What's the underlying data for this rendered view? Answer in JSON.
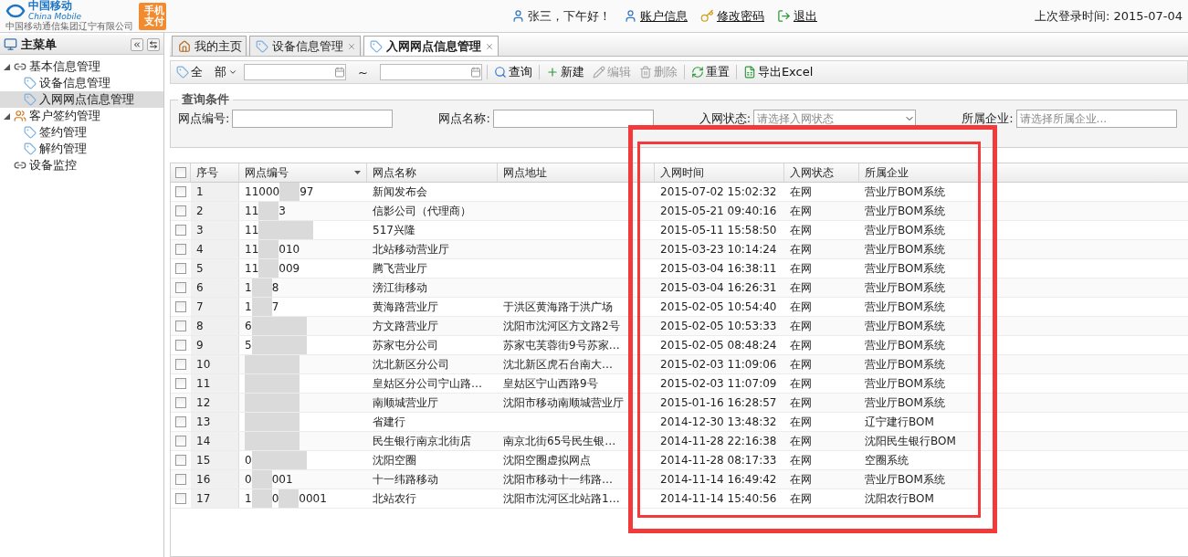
{
  "header": {
    "brand": {
      "name": "中国移动",
      "name_en": "China Mobile",
      "company": "中国移动通信集团辽宁有限公司",
      "app_badge": "手机支付"
    },
    "greeting": "张三，下午好！",
    "links": [
      "账户信息",
      "修改密码",
      "退出"
    ],
    "last_login": "上次登录时间: 2015-07-04"
  },
  "sidebar": {
    "title": "主菜单",
    "items": [
      {
        "label": "基本信息管理",
        "expanded": true,
        "selected": false,
        "children": [
          {
            "label": "设备信息管理",
            "selected": false
          },
          {
            "label": "入网网点信息管理",
            "selected": true
          }
        ]
      },
      {
        "label": "客户签约管理",
        "expanded": true,
        "selected": false,
        "children": [
          {
            "label": "签约管理",
            "selected": false
          },
          {
            "label": "解约管理",
            "selected": false
          }
        ]
      },
      {
        "label": "设备监控",
        "selected": false
      }
    ]
  },
  "tabs": [
    {
      "label": "我的主页",
      "selected": false,
      "closable": false
    },
    {
      "label": "设备信息管理",
      "selected": false,
      "closable": true
    },
    {
      "label": "入网网点信息管理",
      "selected": true,
      "closable": true
    }
  ],
  "toolbar": {
    "range_select": "全　部",
    "range_separator": "~",
    "buttons": [
      {
        "label": "查询",
        "disabled": false
      },
      {
        "label": "新建",
        "disabled": false
      },
      {
        "label": "编辑",
        "disabled": true
      },
      {
        "label": "删除",
        "disabled": true
      },
      {
        "label": "重置",
        "disabled": false
      },
      {
        "label": "导出Excel",
        "disabled": false
      }
    ]
  },
  "query": {
    "legend": "查询条件",
    "fields": [
      {
        "label": "网点编号:",
        "kind": "input"
      },
      {
        "label": "网点名称:",
        "kind": "input"
      },
      {
        "label": "入网状态:",
        "kind": "select",
        "placeholder": "请选择入网状态"
      },
      {
        "label": "所属企业:",
        "kind": "input",
        "placeholder": "请选择所属企业..."
      }
    ]
  },
  "table": {
    "all_checked": false,
    "columns": [
      "序号",
      "网点编号",
      "网点名称",
      "网点地址",
      "入网时间",
      "入网状态",
      "所属企业"
    ],
    "rows": [
      {
        "checked": false,
        "no": "1",
        "id_parts": [
          "11000",
          "97"
        ],
        "name": "新闻发布会",
        "time": "2015-07-02 15:02:32",
        "status": "在网",
        "company": "营业厅BOM系统"
      },
      {
        "checked": false,
        "no": "2",
        "id_parts": [
          "11",
          "3"
        ],
        "name": "信影公司（代理商）",
        "time": "2015-05-21 09:40:16",
        "status": "在网",
        "company": "营业厅BOM系统"
      },
      {
        "checked": false,
        "no": "3",
        "id_parts": [
          "11"
        ],
        "name": "517兴隆",
        "time": "2015-05-11 15:58:50",
        "status": "在网",
        "company": "营业厅BOM系统"
      },
      {
        "checked": false,
        "no": "4",
        "id_parts": [
          "11",
          "010"
        ],
        "name": "北站移动营业厅",
        "time": "2015-03-23 10:14:24",
        "status": "在网",
        "company": "营业厅BOM系统"
      },
      {
        "checked": false,
        "no": "5",
        "id_parts": [
          "11",
          "009"
        ],
        "name": "腾飞营业厅",
        "time": "2015-03-04 16:38:11",
        "status": "在网",
        "company": "营业厅BOM系统"
      },
      {
        "checked": false,
        "no": "6",
        "id_parts": [
          "1",
          "8"
        ],
        "name": "滂江街移动",
        "time": "2015-03-04 16:26:31",
        "status": "在网",
        "company": "营业厅BOM系统"
      },
      {
        "checked": false,
        "no": "7",
        "id_parts": [
          "1",
          "7"
        ],
        "name": "黄海路营业厅",
        "address": "于洪区黄海路于洪广场",
        "time": "2015-02-05 10:54:40",
        "status": "在网",
        "company": "营业厅BOM系统"
      },
      {
        "checked": false,
        "no": "8",
        "id_parts": [
          "6"
        ],
        "name": "方文路营业厅",
        "address": "沈阳市沈河区方文路2号",
        "time": "2015-02-05 10:53:33",
        "status": "在网",
        "company": "营业厅BOM系统"
      },
      {
        "checked": false,
        "no": "9",
        "id_parts": [
          "5"
        ],
        "name": "苏家屯分公司",
        "address": "苏家屯芙蓉街9号苏家…",
        "time": "2015-02-05 08:48:24",
        "status": "在网",
        "company": "营业厅BOM系统"
      },
      {
        "checked": false,
        "no": "10",
        "name": "沈北新区分公司",
        "address": "沈北新区虎石台南大…",
        "time": "2015-02-03 11:09:06",
        "status": "在网",
        "company": "营业厅BOM系统"
      },
      {
        "checked": false,
        "no": "11",
        "name": "皇姑区分公司宁山路…",
        "address": "皇姑区宁山西路9号",
        "time": "2015-02-03 11:07:09",
        "status": "在网",
        "company": "营业厅BOM系统"
      },
      {
        "checked": false,
        "no": "12",
        "name": "南顺城营业厅",
        "address": "沈阳市移动南顺城营业厅",
        "time": "2015-01-16 16:28:57",
        "status": "在网",
        "company": "营业厅BOM系统"
      },
      {
        "checked": false,
        "no": "13",
        "name": "省建行",
        "time": "2014-12-30 13:48:32",
        "status": "在网",
        "company": "辽宁建行BOM"
      },
      {
        "checked": false,
        "no": "14",
        "name": "民生银行南京北街店",
        "address": "南京北街65号民生银…",
        "time": "2014-11-28 22:16:38",
        "status": "在网",
        "company": "沈阳民生银行BOM"
      },
      {
        "checked": false,
        "no": "15",
        "id_parts": [
          "0"
        ],
        "name": "沈阳空圈",
        "address": "沈阳空圈虚拟网点",
        "time": "2014-11-28 08:17:33",
        "status": "在网",
        "company": "空圈系统"
      },
      {
        "checked": false,
        "no": "16",
        "id_parts": [
          "0",
          "001"
        ],
        "name": "十一纬路移动",
        "address": "沈阳市移动十一纬路…",
        "time": "2014-11-14 16:49:42",
        "status": "在网",
        "company": "营业厅BOM系统"
      },
      {
        "checked": false,
        "no": "17",
        "id_parts": [
          "1",
          "0",
          "0001"
        ],
        "name": "北站农行",
        "address": "沈阳市沈河区北站路1…",
        "time": "2014-11-14 15:40:56",
        "status": "在网",
        "company": "沈阳农行BOM"
      }
    ]
  }
}
